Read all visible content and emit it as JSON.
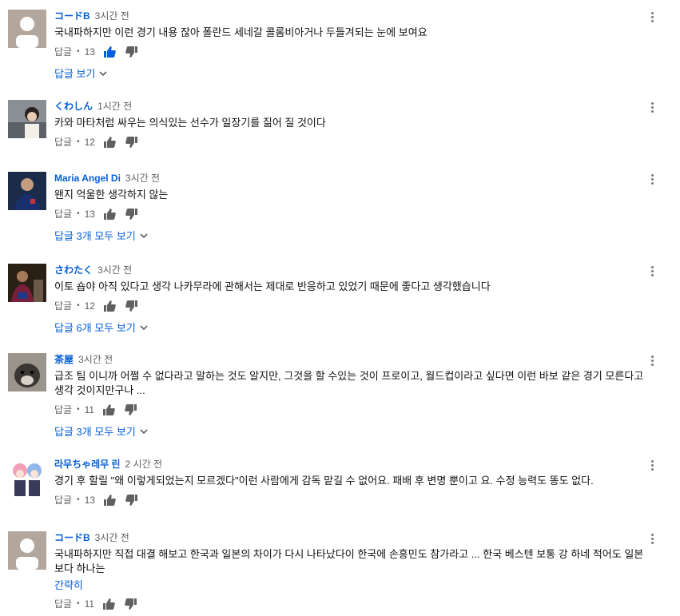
{
  "comments": [
    {
      "author": "コードB",
      "time": "3시간 전",
      "text": "국내파하지만 이런 경기 내용 잖아 폴란드 세네갈 콜롬비아거나 두들겨되는 눈에 보여요",
      "reply_label": "답글",
      "likes": "13",
      "liked": true,
      "view_replies": "답글 보기",
      "avatar": "default"
    },
    {
      "author": "くわしん",
      "time": "1시간 전",
      "text": "카와 마타처럼 싸우는 의식있는 선수가 일장기를 짊어 질 것이다",
      "reply_label": "답글",
      "likes": "12",
      "liked": false,
      "avatar": "photo-person"
    },
    {
      "author": "Maria Angel Di",
      "time": "3시간 전",
      "text": "왠지 억울한 생각하지 않는",
      "reply_label": "답글",
      "likes": "13",
      "liked": false,
      "view_replies": "답글 3개 모두 보기",
      "avatar": "photo-player"
    },
    {
      "author": "さわたく",
      "time": "3시간 전",
      "text": "이토 숍야 아직 있다고 생각 나카무라에 관해서는 제대로 반응하고 있었기 때문에 좋다고 생각했습니다",
      "reply_label": "답글",
      "likes": "12",
      "liked": false,
      "view_replies": "답글 6개 모두 보기",
      "avatar": "photo-player"
    },
    {
      "author": "茶屋",
      "time": "3시간 전",
      "text": "급조 팀 이니까 어쩔 수 없다라고 말하는 것도 알지만, 그것을 할 수있는 것이 프로이고, 월드컵이라고 싶다면 이런 바보 같은 경기 모른다고 생각 것이지만구나 ...",
      "reply_label": "답글",
      "likes": "11",
      "liked": false,
      "view_replies": "답글 3개 모두 보기",
      "avatar": "photo-dog"
    },
    {
      "author": "라무ちゃ레무 린",
      "time": "2 시간 전",
      "text": "경기 후 할릴 \"왜 이렇게되었는지 모르겠다\"이런 사람에게 감독 맡길 수 없어요. 패배 후 변명 뿐이고 요. 수정 능력도 똥도 없다.",
      "reply_label": "답글",
      "likes": "13",
      "liked": false,
      "avatar": "photo-anime"
    },
    {
      "author": "コードB",
      "time": "3시간 전",
      "text": "국내파하지만 직접 대결 해보고 한국과 일본의 차이가 다시 나타났다이 한국에 손흥민도 참가라고 ... 한국 베스텐 보통 강 하네 적어도 일본보다 하나는",
      "read_less": "간략히",
      "reply_label": "답글",
      "likes": "11",
      "liked": false,
      "avatar": "default"
    }
  ],
  "colors": {
    "link": "#065fd4",
    "liked": "#065fd4",
    "muted": "#606060"
  }
}
